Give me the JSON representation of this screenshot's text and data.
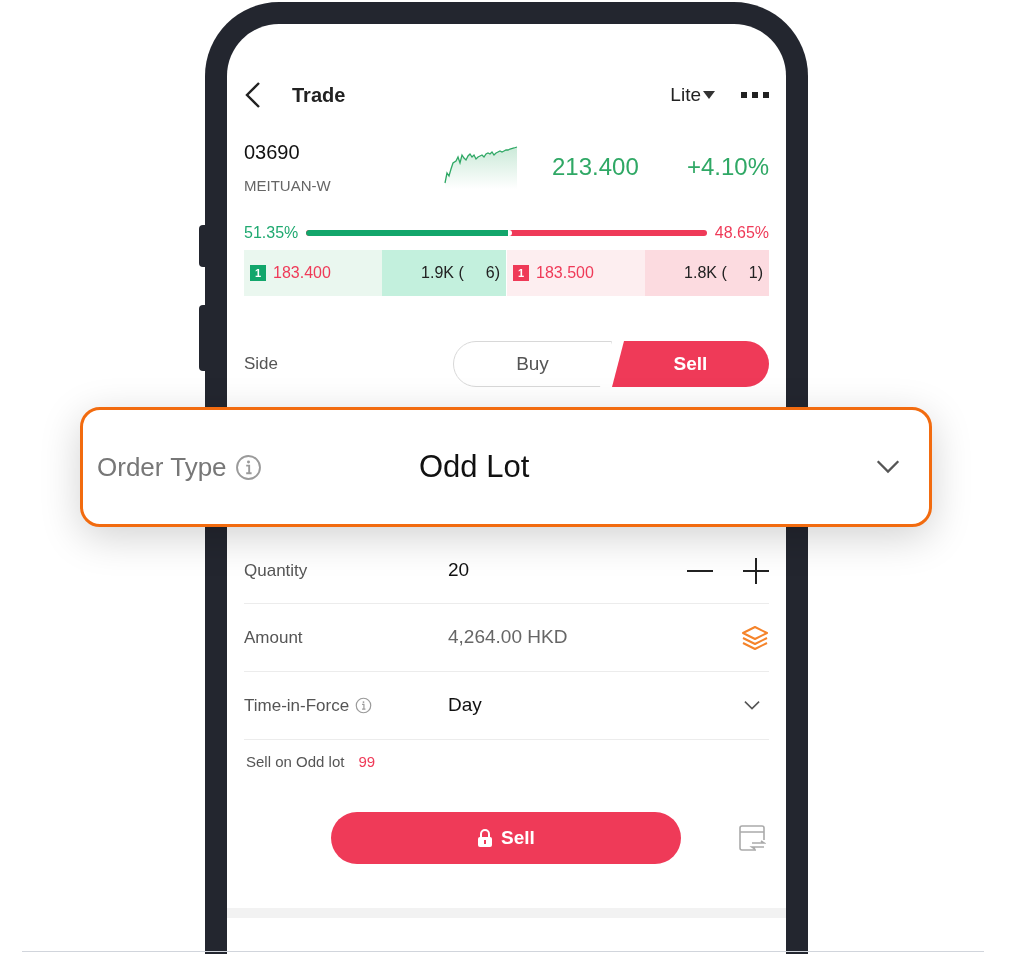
{
  "header": {
    "title": "Trade",
    "mode": "Lite"
  },
  "stock": {
    "code": "03690",
    "name": "MEITUAN-W",
    "price": "213.400",
    "change": "+4.10%"
  },
  "ratio": {
    "bid": "51.35%",
    "ask": "48.65%",
    "level": 0.5135
  },
  "book": [
    {
      "kind": "bid",
      "rank": "1",
      "price": "183.400",
      "volume": "1.9K (",
      "count": "6)"
    },
    {
      "kind": "ask",
      "rank": "1",
      "price": "183.500",
      "volume": "1.8K (",
      "count": "1)"
    }
  ],
  "side": {
    "label": "Side",
    "options": [
      {
        "label": "Buy",
        "selected": false
      },
      {
        "label": "Sell",
        "selected": true
      }
    ]
  },
  "order_type": {
    "label": "Order Type",
    "value": "Odd Lot"
  },
  "fields": [
    {
      "kind": "stepper",
      "label": "Quantity",
      "info": false,
      "value": "20"
    },
    {
      "kind": "amount",
      "label": "Amount",
      "info": false,
      "value": "4,264.00 HKD"
    },
    {
      "kind": "select",
      "label": "Time-in-Force",
      "info": true,
      "value": "Day"
    }
  ],
  "note": {
    "label": "Sell on Odd lot",
    "count": "99"
  },
  "submit": {
    "label": "Sell"
  }
}
